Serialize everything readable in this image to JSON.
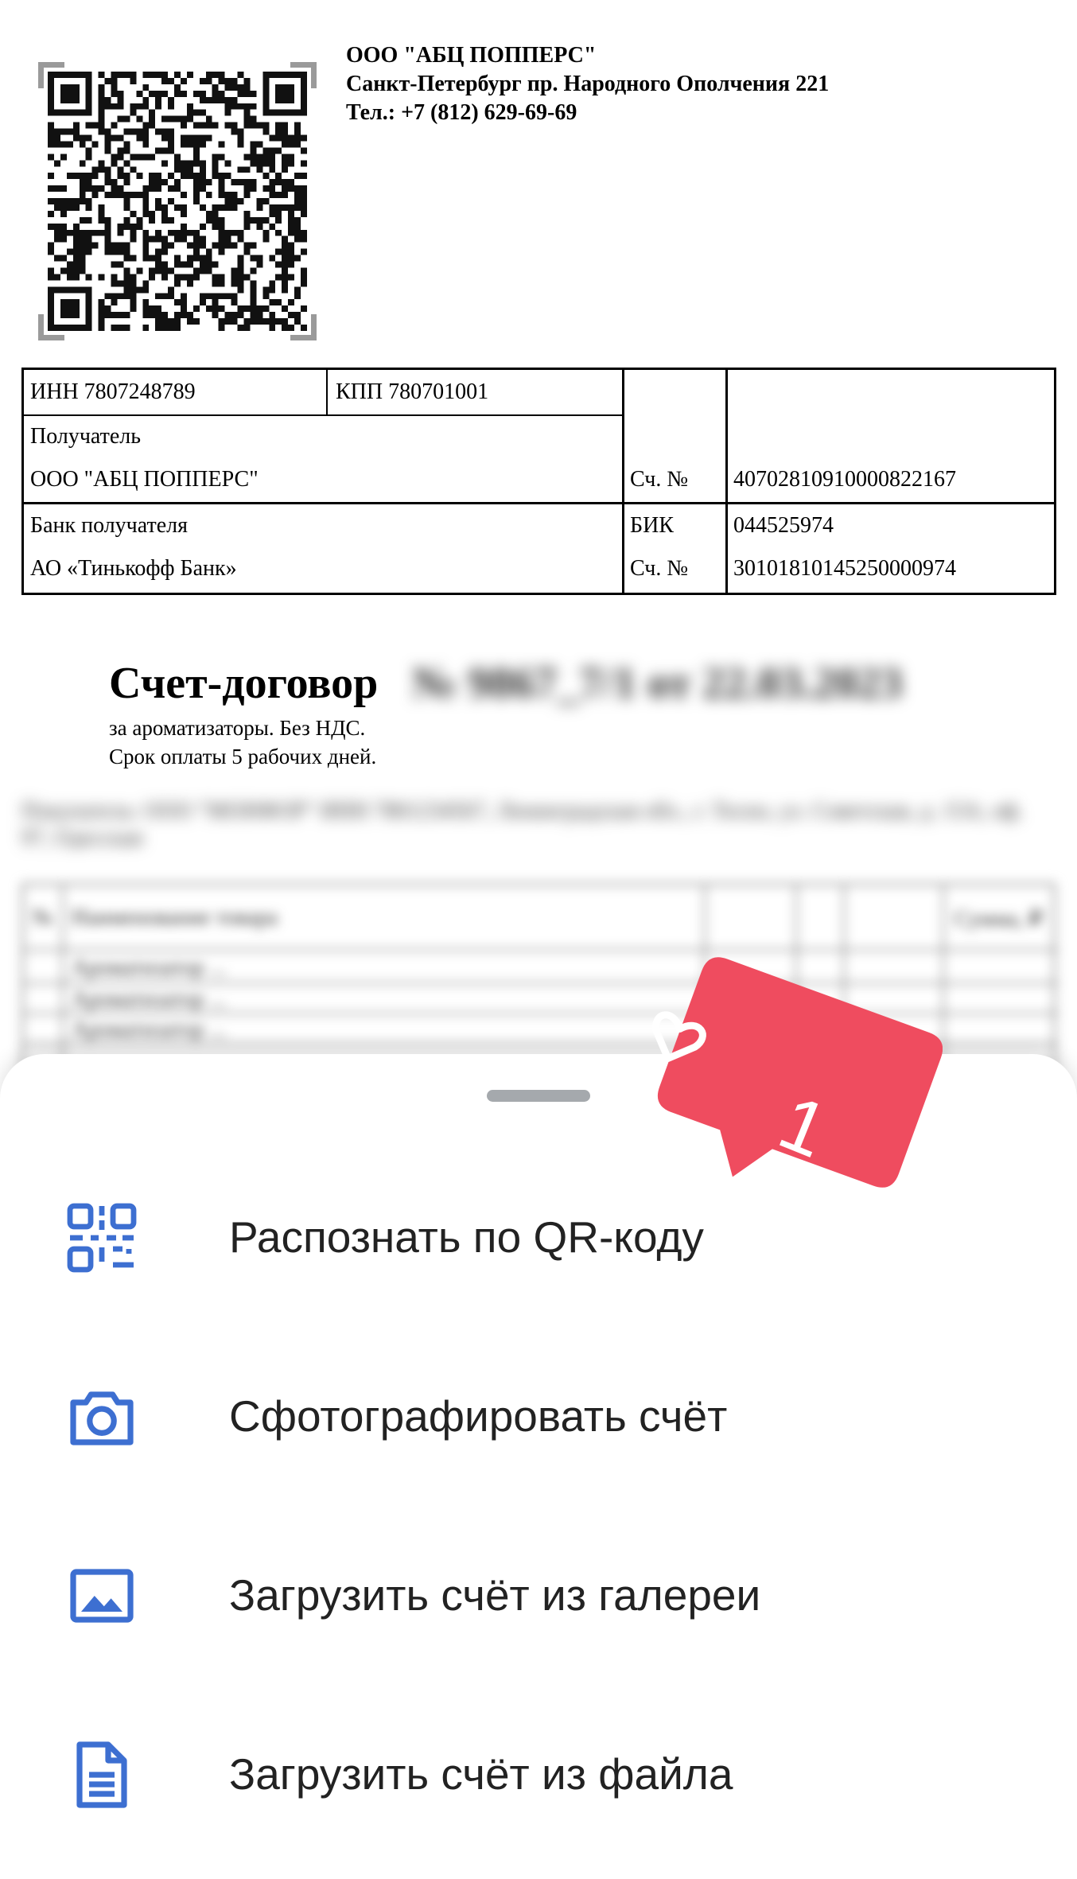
{
  "company": {
    "name": "ООО \"АБЦ ПОППЕРС\"",
    "address": "Санкт-Петербург пр. Народного Ополчения 221",
    "phone": "Тел.: +7 (812) 629-69-69"
  },
  "bank_details": {
    "inn": "ИНН 7807248789",
    "kpp": "КПП 780701001",
    "recipient_label": "Получатель",
    "recipient_name": "ООО \"АБЦ ПОППЕРС\"",
    "account_label": "Сч. №",
    "account_number": "40702810910000822167",
    "bank_label": "Банк получателя",
    "bank_name": "АО «Тинькофф Банк»",
    "bik_label": "БИК",
    "bik": "044525974",
    "corr_account_label": "Сч. №",
    "corr_account": "30101810145250000974"
  },
  "invoice": {
    "title": "Счет-договор",
    "number_blurred": "№ 9867_7/1 от 22.03.2023",
    "purpose": "за ароматизаторы. Без НДС.",
    "payment_term": "Срок оплаты 5 рабочих дней."
  },
  "menu": {
    "items": [
      {
        "label": "Распознать по QR-коду",
        "icon": "qr-scan-icon"
      },
      {
        "label": "Сфотографировать счёт",
        "icon": "camera-icon"
      },
      {
        "label": "Загрузить счёт из галереи",
        "icon": "gallery-icon"
      },
      {
        "label": "Загрузить счёт из файла",
        "icon": "file-icon"
      }
    ]
  },
  "notification": {
    "icon": "heart-icon",
    "count": "1"
  },
  "colors": {
    "accent_blue": "#3d6fd1",
    "like_red": "#ef4c5f",
    "handle_gray": "#a5a9ad"
  }
}
